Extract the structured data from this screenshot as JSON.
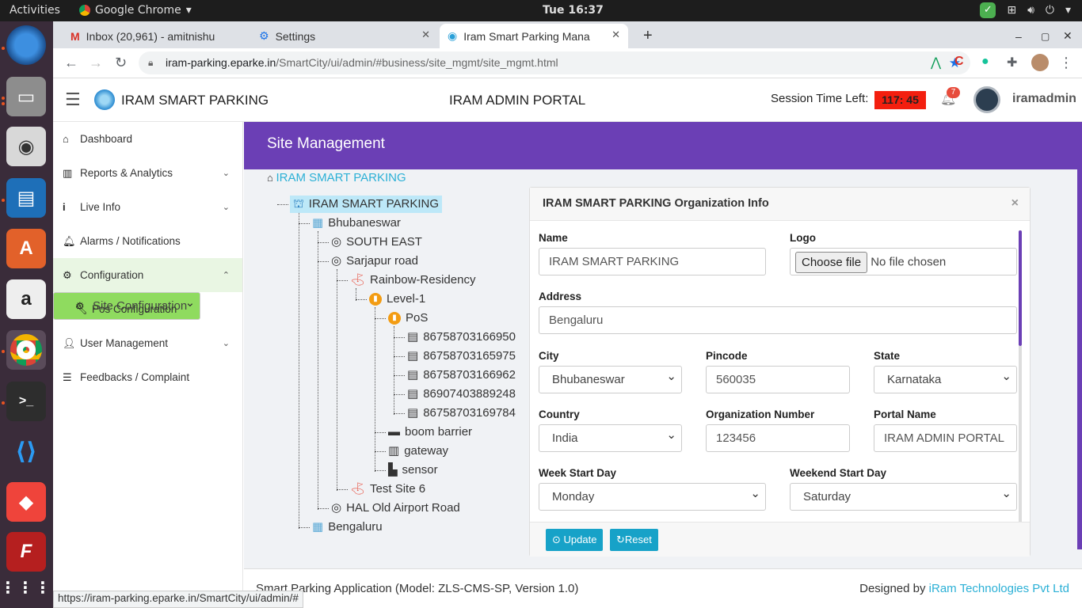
{
  "os": {
    "activities": "Activities",
    "app": "Google Chrome",
    "clock": "Tue 16:37"
  },
  "tabs": [
    {
      "label": "Inbox (20,961) - amitnishu"
    },
    {
      "label": "Settings"
    },
    {
      "label": "Iram Smart Parking Mana"
    }
  ],
  "url": {
    "host": "iram-parking.eparke.in",
    "path": "/SmartCity/ui/admin/#business/site_mgmt/site_mgmt.html"
  },
  "header": {
    "brand": "IRAM SMART PARKING",
    "portal": "IRAM ADMIN PORTAL",
    "session_label": "Session Time Left:",
    "session_time": "117: 45",
    "notif_count": "7",
    "user": "iramadmin"
  },
  "sidebar": {
    "items": [
      {
        "label": "Dashboard",
        "icon": "home-icon"
      },
      {
        "label": "Reports & Analytics",
        "icon": "chart-icon"
      },
      {
        "label": "Live Info",
        "icon": "info-icon"
      },
      {
        "label": "Alarms / Notifications",
        "icon": "bell-icon"
      },
      {
        "label": "Configuration",
        "icon": "gears-icon"
      },
      {
        "label": "Site Configuration",
        "icon": "gear-icon"
      },
      {
        "label": "Pos Configuration",
        "icon": "wrench-icon"
      },
      {
        "label": "User Management",
        "icon": "user-icon"
      },
      {
        "label": "Feedbacks / Complaint",
        "icon": "list-icon"
      }
    ]
  },
  "page": {
    "title": "Site Management",
    "breadcrumb": "IRAM SMART PARKING"
  },
  "tree": {
    "nodes": [
      "IRAM SMART PARKING",
      "Bhubaneswar",
      "SOUTH EAST",
      "Sarjapur road",
      "Rainbow-Residency",
      "Level-1",
      "PoS",
      "86758703166950",
      "86758703165975",
      "86758703166962",
      "86907403889248",
      "86758703169784",
      "boom barrier",
      "gateway",
      "sensor",
      "Test Site 6",
      "HAL Old Airport Road",
      "Bengaluru"
    ]
  },
  "panel": {
    "title": "IRAM SMART PARKING Organization Info",
    "name_label": "Name",
    "name_value": "IRAM SMART PARKING",
    "logo_label": "Logo",
    "choose_file": "Choose file",
    "no_file": "No file chosen",
    "address_label": "Address",
    "address_value": "Bengaluru",
    "city_label": "City",
    "city_value": "Bhubaneswar",
    "pincode_label": "Pincode",
    "pincode_value": "560035",
    "state_label": "State",
    "state_value": "Karnataka",
    "country_label": "Country",
    "country_value": "India",
    "org_label": "Organization Number",
    "org_value": "123456",
    "portal_label": "Portal Name",
    "portal_value": "IRAM ADMIN PORTAL",
    "week_label": "Week Start Day",
    "week_value": "Monday",
    "weekend_label": "Weekend Start Day",
    "weekend_value": "Saturday",
    "update": "Update",
    "reset": "Reset"
  },
  "footer": {
    "app": "Smart Parking Application (Model: ZLS-CMS-SP, Version 1.0)",
    "designed_by": "Designed by",
    "company": "iRam Technologies Pvt Ltd"
  },
  "status_url": "https://iram-parking.eparke.in/SmartCity/ui/admin/#"
}
